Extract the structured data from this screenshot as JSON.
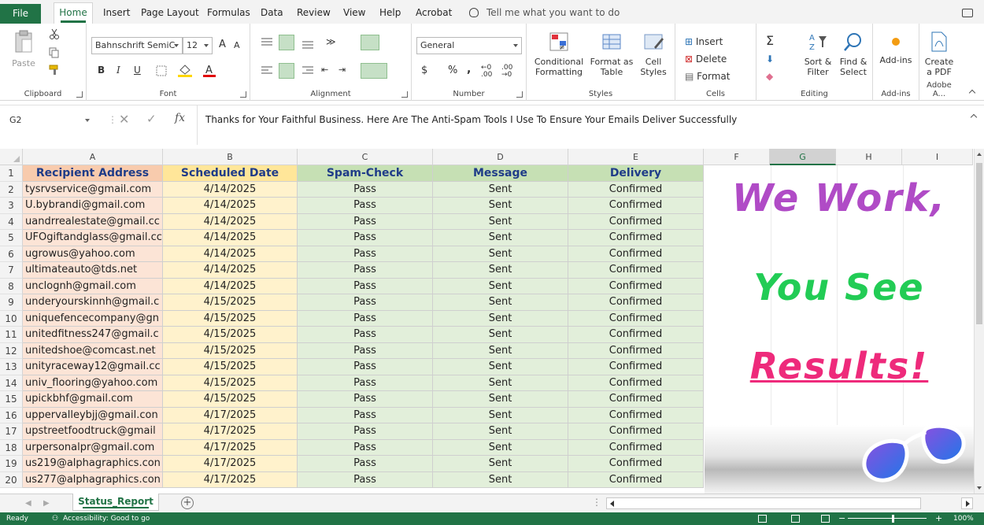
{
  "menu": {
    "file": "File",
    "tabs": [
      "Home",
      "Insert",
      "Page Layout",
      "Formulas",
      "Data",
      "Review",
      "View",
      "Help",
      "Acrobat"
    ],
    "tell_me": "Tell me what you want to do"
  },
  "ribbon": {
    "clipboard": {
      "label": "Clipboard",
      "paste": "Paste"
    },
    "font": {
      "label": "Font",
      "name": "Bahnschrift SemiC",
      "size": "12",
      "bold": "B",
      "italic": "I",
      "underline": "U",
      "grow": "A",
      "shrink": "A"
    },
    "alignment": {
      "label": "Alignment"
    },
    "number": {
      "label": "Number",
      "format": "General",
      "currency": "$",
      "percent": "%",
      "comma": ","
    },
    "styles": {
      "label": "Styles",
      "conditional": [
        "Conditional",
        "Formatting"
      ],
      "format_table": [
        "Format as",
        "Table"
      ],
      "cell_styles": [
        "Cell",
        "Styles"
      ]
    },
    "cells": {
      "label": "Cells",
      "insert": "Insert",
      "delete": "Delete",
      "format": "Format"
    },
    "editing": {
      "label": "Editing",
      "sort": [
        "Sort &",
        "Filter"
      ],
      "find": [
        "Find &",
        "Select"
      ]
    },
    "addins": {
      "label": "Add-ins",
      "button": "Add-ins"
    },
    "adobe": {
      "label": "Adobe A...",
      "button": [
        "Create",
        "a PDF"
      ]
    }
  },
  "formula_bar": {
    "name_box": "G2",
    "fx": "fx",
    "content": "Thanks for Your Faithful Business. Here Are The Anti-Spam Tools I Use To Ensure Your Emails Deliver Successfully"
  },
  "grid": {
    "columns": [
      "A",
      "B",
      "C",
      "D",
      "E",
      "F",
      "G",
      "H",
      "I"
    ],
    "selected_column": "G",
    "headers": [
      "Recipient Address",
      "Scheduled Date",
      "Spam-Check",
      "Message",
      "Delivery"
    ],
    "rows": [
      [
        "tysrvservice@gmail.com",
        "4/14/2025",
        "Pass",
        "Sent",
        "Confirmed"
      ],
      [
        "U.bybrandi@gmail.com",
        "4/14/2025",
        "Pass",
        "Sent",
        "Confirmed"
      ],
      [
        "uandrrealestate@gmail.cc",
        "4/14/2025",
        "Pass",
        "Sent",
        "Confirmed"
      ],
      [
        "UFOgiftandglass@gmail.cc",
        "4/14/2025",
        "Pass",
        "Sent",
        "Confirmed"
      ],
      [
        "ugrowus@yahoo.com",
        "4/14/2025",
        "Pass",
        "Sent",
        "Confirmed"
      ],
      [
        "ultimateauto@tds.net",
        "4/14/2025",
        "Pass",
        "Sent",
        "Confirmed"
      ],
      [
        "unclognh@gmail.com",
        "4/14/2025",
        "Pass",
        "Sent",
        "Confirmed"
      ],
      [
        "underyourskinnh@gmail.c",
        "4/15/2025",
        "Pass",
        "Sent",
        "Confirmed"
      ],
      [
        "uniquefencecompany@gn",
        "4/15/2025",
        "Pass",
        "Sent",
        "Confirmed"
      ],
      [
        "unitedfitness247@gmail.c",
        "4/15/2025",
        "Pass",
        "Sent",
        "Confirmed"
      ],
      [
        "unitedshoe@comcast.net",
        "4/15/2025",
        "Pass",
        "Sent",
        "Confirmed"
      ],
      [
        "unityraceway12@gmail.cc",
        "4/15/2025",
        "Pass",
        "Sent",
        "Confirmed"
      ],
      [
        "univ_flooring@yahoo.com",
        "4/15/2025",
        "Pass",
        "Sent",
        "Confirmed"
      ],
      [
        "upickbhf@gmail.com",
        "4/15/2025",
        "Pass",
        "Sent",
        "Confirmed"
      ],
      [
        "uppervalleybjj@gmail.con",
        "4/17/2025",
        "Pass",
        "Sent",
        "Confirmed"
      ],
      [
        "upstreetfoodtruck@gmail",
        "4/17/2025",
        "Pass",
        "Sent",
        "Confirmed"
      ],
      [
        "urpersonalpr@gmail.com",
        "4/17/2025",
        "Pass",
        "Sent",
        "Confirmed"
      ],
      [
        "us219@alphagraphics.con",
        "4/17/2025",
        "Pass",
        "Sent",
        "Confirmed"
      ],
      [
        "us277@alphagraphics.con",
        "4/17/2025",
        "Pass",
        "Sent",
        "Confirmed"
      ]
    ]
  },
  "promo": {
    "line1": "We Work,",
    "line2": "You See",
    "line3": "Results!"
  },
  "sheets": {
    "active": "Status_Report",
    "add": "+"
  },
  "status": {
    "ready": "Ready",
    "accessibility": "Accessibility: Good to go",
    "zoom": "100%"
  },
  "colors": {
    "excel_green": "#217346",
    "col_a": "#fce4d6",
    "col_b": "#fff2cc",
    "col_green": "#e2efda",
    "header_text": "#1f3c88"
  }
}
